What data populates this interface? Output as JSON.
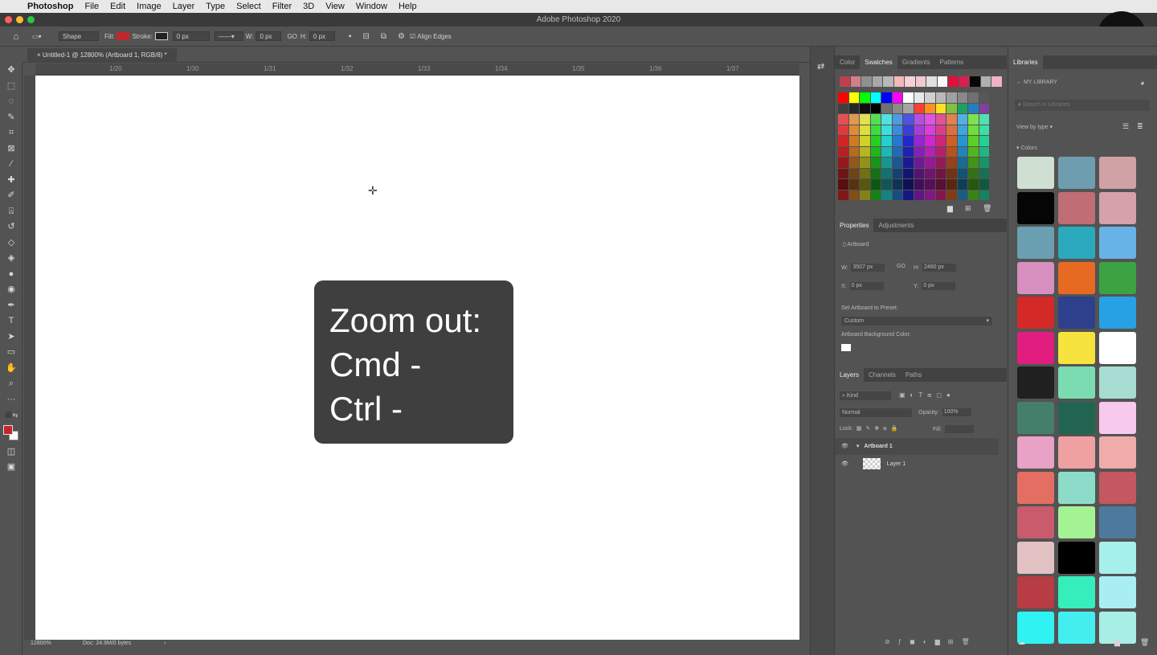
{
  "menubar": {
    "app": "Photoshop",
    "items": [
      "File",
      "Edit",
      "Image",
      "Layer",
      "Type",
      "Select",
      "Filter",
      "3D",
      "View",
      "Window",
      "Help"
    ]
  },
  "window": {
    "title": "Adobe Photoshop 2020"
  },
  "options": {
    "tool": "Shape",
    "fill_label": "Fill:",
    "fill_color": "#c1272d",
    "stroke_label": "Stroke:",
    "stroke_width": "0 px",
    "w_label": "W:",
    "w_value": "0 px",
    "link": "GO",
    "h_label": "H:",
    "h_value": "0 px",
    "align_edges": "Align Edges"
  },
  "document": {
    "tab": "Untitled-1 @ 12800% (Artboard 1, RGB/8) *",
    "ruler_ticks": [
      "1/20",
      "1/30",
      "1/31",
      "1/32",
      "1/33",
      "1/34",
      "1/35",
      "1/36",
      "1/37"
    ]
  },
  "overlay": {
    "line1": "Zoom out:",
    "line2": "Cmd -",
    "line3": "Ctrl -"
  },
  "status": {
    "zoom": "12800%",
    "doc": "Doc: 24.9M/0 bytes",
    "arrow": "›"
  },
  "swatches_panel": {
    "tabs": [
      "Color",
      "Swatches",
      "Gradients",
      "Patterns"
    ],
    "active": "Swatches"
  },
  "properties": {
    "tabs": [
      "Properties",
      "Adjustments"
    ],
    "kind": "Artboard",
    "w_label": "W:",
    "w_value": "3507 px",
    "link": "GO",
    "h_label": "H:",
    "h_value": "2480 px",
    "x_label": "X:",
    "x_value": "0 px",
    "y_label": "Y:",
    "y_value": "0 px",
    "preset_label": "Set Artboard to Preset:",
    "preset_value": "Custom",
    "bg_label": "Artboard Background Color:"
  },
  "layers": {
    "tabs": [
      "Layers",
      "Channels",
      "Paths"
    ],
    "filter": "Kind",
    "blend": "Normal",
    "opacity_label": "Opacity:",
    "opacity": "100%",
    "lock_label": "Lock:",
    "fill_label": "Fill:",
    "items": [
      "Artboard 1",
      "Layer 1"
    ]
  },
  "libraries": {
    "tab": "Libraries",
    "name": "MY LIBRARY",
    "search_placeholder": "Search in Libraries",
    "view": "View by type",
    "section": "Colors",
    "colors": [
      "#cfdfd2",
      "#6e9db0",
      "#d0a2a6",
      "#050505",
      "#c06e73",
      "#d4a2a8",
      "#6a9fb1",
      "#2aa9bd",
      "#67b2e6",
      "#d68fbf",
      "#e76a23",
      "#3ba342",
      "#d42a27",
      "#2e3f8c",
      "#27a0e4",
      "#e11e7f",
      "#f7e33d",
      "#ffffff",
      "#202020",
      "#7bdcb2",
      "#a6dcd2",
      "#447f6c",
      "#216551",
      "#f7c9ec",
      "#e8a2c5",
      "#eea1a0",
      "#f0abab",
      "#e46e62",
      "#8ddcca",
      "#c4575f",
      "#c95b6c",
      "#a3f394",
      "#4d7a9c",
      "#e2c1c3",
      "#000000",
      "#a6f0ec",
      "#b83c44",
      "#36eebc",
      "#a9eef2",
      "#31f2f2",
      "#44eeee",
      "#a6eee6"
    ]
  },
  "colors": {
    "fg": "#c1272d",
    "bg": "#ffffff",
    "panel": "#535353",
    "overlay": "#3f3f3f"
  }
}
